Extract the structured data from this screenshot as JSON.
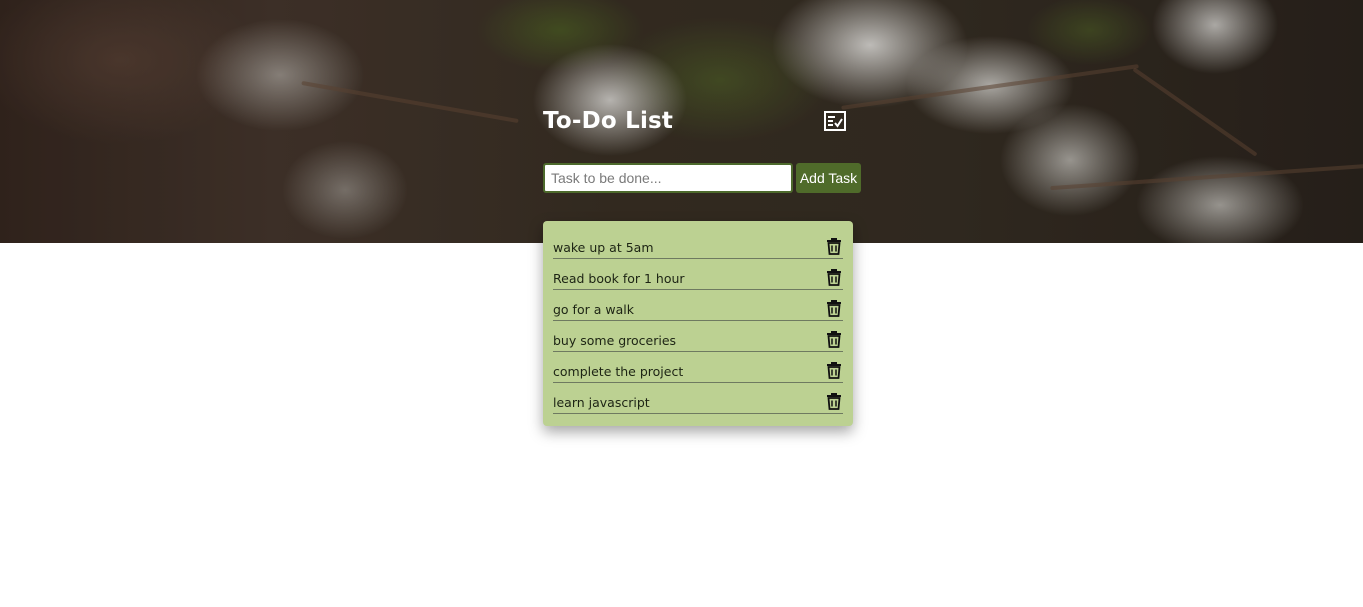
{
  "app": {
    "title": "To-Do List",
    "title_icon": "checklist-icon"
  },
  "form": {
    "placeholder": "Task to be done...",
    "value": "",
    "add_label": "Add Task"
  },
  "tasks": [
    {
      "text": "wake up at 5am"
    },
    {
      "text": "Read book for 1 hour"
    },
    {
      "text": "go for a walk"
    },
    {
      "text": "buy some groceries"
    },
    {
      "text": "complete the project"
    },
    {
      "text": "learn javascript"
    }
  ],
  "colors": {
    "accent": "#4f6b2a",
    "card": "#bcd192"
  }
}
